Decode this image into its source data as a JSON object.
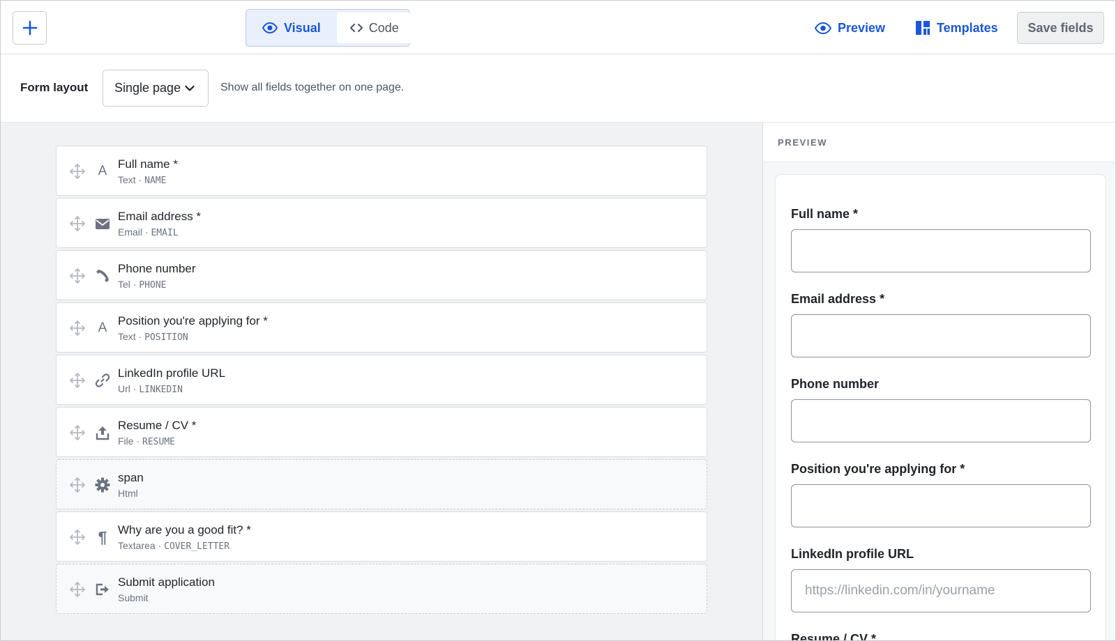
{
  "toolbar": {
    "add_icon": "plus-icon",
    "mode_visual": "Visual",
    "mode_code": "Code",
    "preview_label": "Preview",
    "templates_label": "Templates",
    "save_label": "Save fields",
    "accent_color": "#1a56db"
  },
  "layout_bar": {
    "label": "Form layout",
    "selected": "Single page",
    "help": "Show all fields together on one page."
  },
  "fields": [
    {
      "title": "Full name *",
      "type": "Text",
      "key": "NAME",
      "icon": "text-icon",
      "dashed": false
    },
    {
      "title": "Email address *",
      "type": "Email",
      "key": "EMAIL",
      "icon": "envelope-icon",
      "dashed": false
    },
    {
      "title": "Phone number",
      "type": "Tel",
      "key": "PHONE",
      "icon": "phone-icon",
      "dashed": false
    },
    {
      "title": "Position you're applying for *",
      "type": "Text",
      "key": "POSITION",
      "icon": "text-icon",
      "dashed": false
    },
    {
      "title": "LinkedIn profile URL",
      "type": "Url",
      "key": "LINKEDIN",
      "icon": "link-icon",
      "dashed": false
    },
    {
      "title": "Resume / CV *",
      "type": "File",
      "key": "RESUME",
      "icon": "upload-icon",
      "dashed": false
    },
    {
      "title": "span",
      "type": "Html",
      "key": "",
      "icon": "gear-icon",
      "dashed": true
    },
    {
      "title": "Why are you a good fit? *",
      "type": "Textarea",
      "key": "COVER_LETTER",
      "icon": "paragraph-icon",
      "dashed": false
    },
    {
      "title": "Submit application",
      "type": "Submit",
      "key": "",
      "icon": "submit-icon",
      "dashed": true
    }
  ],
  "preview": {
    "heading": "PREVIEW",
    "fields": [
      {
        "label": "Full name *",
        "placeholder": ""
      },
      {
        "label": "Email address *",
        "placeholder": ""
      },
      {
        "label": "Phone number",
        "placeholder": ""
      },
      {
        "label": "Position you're applying for *",
        "placeholder": ""
      },
      {
        "label": "LinkedIn profile URL",
        "placeholder": "https://linkedin.com/in/yourname"
      },
      {
        "label": "Resume / CV *",
        "placeholder": ""
      }
    ]
  }
}
